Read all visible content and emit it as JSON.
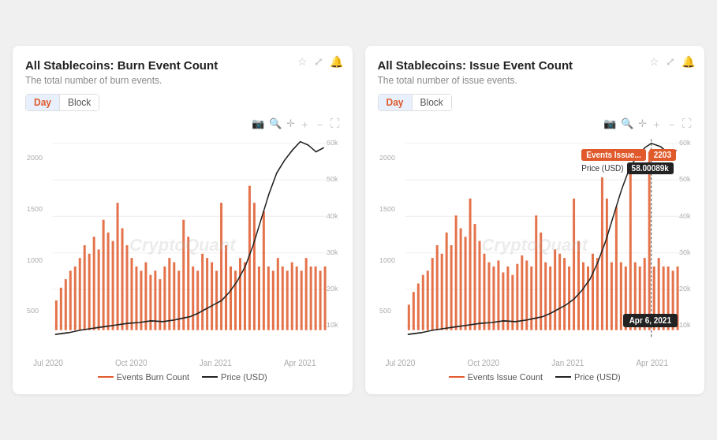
{
  "card1": {
    "title": "All Stablecoins: Burn Event Count",
    "subtitle": "The total number of burn events.",
    "toggle": {
      "day": "Day",
      "block": "Block"
    },
    "active_toggle": "Day",
    "toolbar": [
      "camera-icon",
      "zoom-icon",
      "plus-icon",
      "plus-square-icon",
      "minus-square-icon",
      "expand-icon"
    ],
    "y_axis_right": [
      "60k",
      "50k",
      "40k",
      "30k",
      "20k",
      "10k"
    ],
    "y_axis_left": [
      "2000",
      "1500",
      "1000",
      "500"
    ],
    "x_axis": [
      "Jul 2020",
      "Oct 2020",
      "Jan 2021",
      "Apr 2021"
    ],
    "watermark": "CryptoQuant",
    "legend": [
      {
        "label": "Events Burn Count",
        "color": "#e05a2b"
      },
      {
        "label": "Price (USD)",
        "color": "#222"
      }
    ]
  },
  "card2": {
    "title": "All Stablecoins: Issue Event Count",
    "subtitle": "The total number of issue events.",
    "toggle": {
      "day": "Day",
      "block": "Block"
    },
    "active_toggle": "Day",
    "toolbar": [
      "camera-icon",
      "zoom-icon",
      "plus-icon",
      "plus-square-icon",
      "minus-square-icon",
      "expand-icon"
    ],
    "y_axis_right": [
      "60k",
      "50k",
      "40k",
      "30k",
      "20k",
      "10k"
    ],
    "y_axis_left": [
      "2000",
      "1500",
      "1000",
      "500"
    ],
    "x_axis": [
      "Jul 2020",
      "Oct 2020",
      "Jan 2021",
      "Apr 2021"
    ],
    "watermark": "CryptoQuant",
    "tooltip": {
      "events_label": "Events Issue...",
      "events_val": "2203",
      "price_label": "Price (USD)",
      "price_val": "58.00089k"
    },
    "date_badge": "Apr 6, 2021",
    "legend": [
      {
        "label": "Events Issue Count",
        "color": "#e05a2b"
      },
      {
        "label": "Price (USD)",
        "color": "#222"
      }
    ]
  }
}
